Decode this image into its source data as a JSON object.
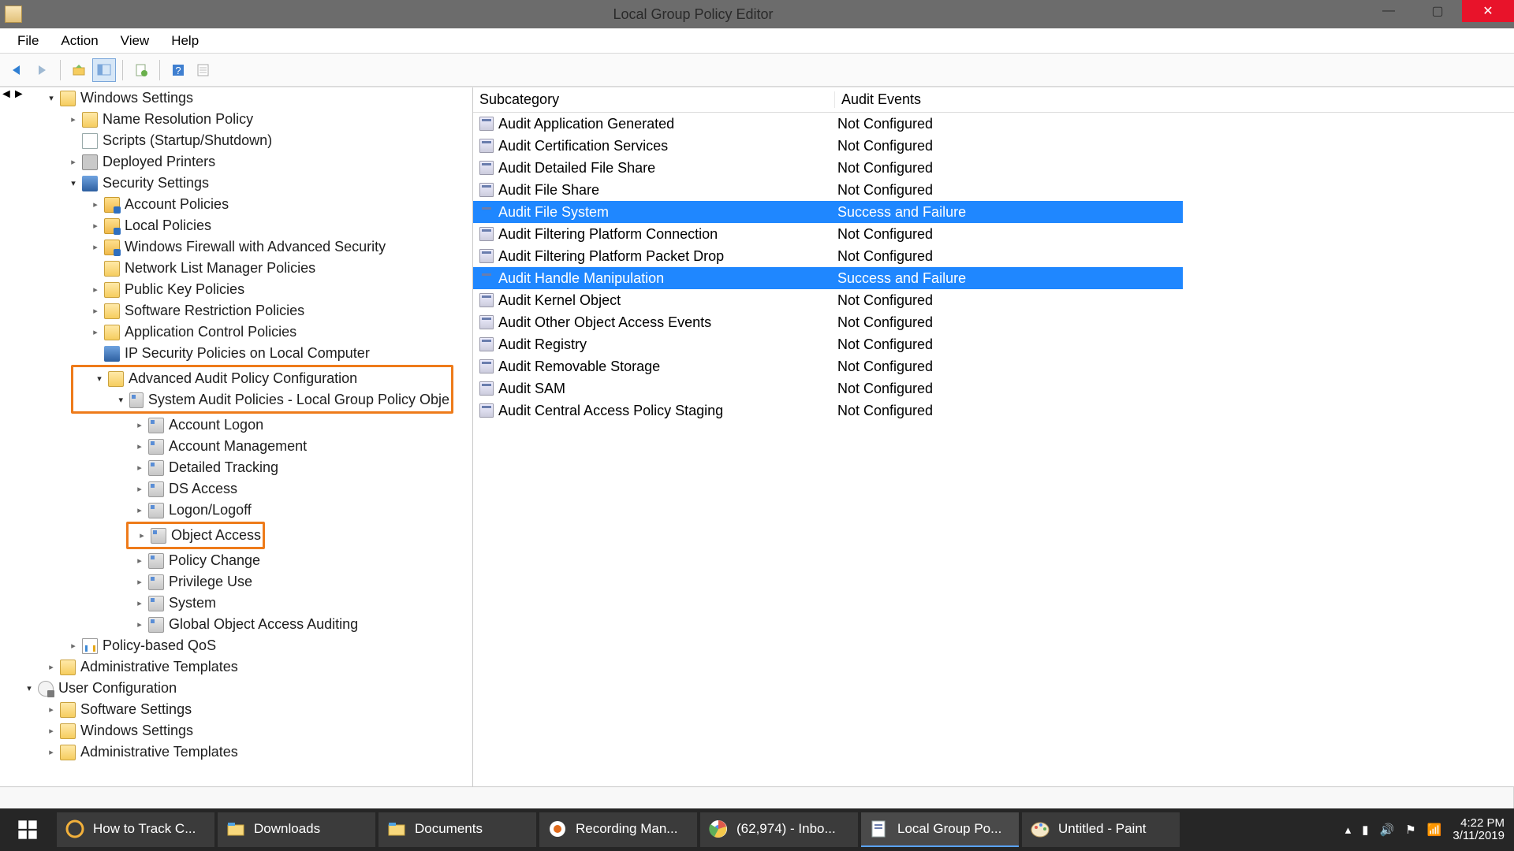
{
  "window": {
    "title": "Local Group Policy Editor",
    "menus": [
      "File",
      "Action",
      "View",
      "Help"
    ]
  },
  "toolbar": {
    "back": "◄",
    "forward": "►",
    "up": "up",
    "showhide": "showhide",
    "export": "export",
    "help": "?",
    "refresh": "refresh"
  },
  "tree": [
    {
      "depth": 1,
      "exp": "▾",
      "icon": "folder",
      "label": "Windows Settings"
    },
    {
      "depth": 2,
      "exp": "▸",
      "icon": "folder",
      "label": "Name Resolution Policy"
    },
    {
      "depth": 2,
      "exp": "",
      "icon": "script",
      "label": "Scripts (Startup/Shutdown)"
    },
    {
      "depth": 2,
      "exp": "▸",
      "icon": "printer",
      "label": "Deployed Printers"
    },
    {
      "depth": 2,
      "exp": "▾",
      "icon": "shield",
      "label": "Security Settings"
    },
    {
      "depth": 3,
      "exp": "▸",
      "icon": "folderlock",
      "label": "Account Policies"
    },
    {
      "depth": 3,
      "exp": "▸",
      "icon": "folderlock",
      "label": "Local Policies"
    },
    {
      "depth": 3,
      "exp": "▸",
      "icon": "folderlock",
      "label": "Windows Firewall with Advanced Security"
    },
    {
      "depth": 3,
      "exp": "",
      "icon": "folder",
      "label": "Network List Manager Policies"
    },
    {
      "depth": 3,
      "exp": "▸",
      "icon": "folder",
      "label": "Public Key Policies"
    },
    {
      "depth": 3,
      "exp": "▸",
      "icon": "folder",
      "label": "Software Restriction Policies"
    },
    {
      "depth": 3,
      "exp": "▸",
      "icon": "folder",
      "label": "Application Control Policies"
    },
    {
      "depth": 3,
      "exp": "",
      "icon": "shield",
      "label": "IP Security Policies on Local Computer"
    },
    {
      "depth": 3,
      "exp": "▾",
      "icon": "folder",
      "label": "Advanced Audit Policy Configuration",
      "hl": true
    },
    {
      "depth": 4,
      "exp": "▾",
      "icon": "catnode",
      "label": "System Audit Policies - Local Group Policy Obje",
      "hl": true
    },
    {
      "depth": 5,
      "exp": "▸",
      "icon": "catnode",
      "label": "Account Logon"
    },
    {
      "depth": 5,
      "exp": "▸",
      "icon": "catnode",
      "label": "Account Management"
    },
    {
      "depth": 5,
      "exp": "▸",
      "icon": "catnode",
      "label": "Detailed Tracking"
    },
    {
      "depth": 5,
      "exp": "▸",
      "icon": "catnode",
      "label": "DS Access"
    },
    {
      "depth": 5,
      "exp": "▸",
      "icon": "catnode",
      "label": "Logon/Logoff"
    },
    {
      "depth": 5,
      "exp": "▸",
      "icon": "catnode",
      "label": "Object Access",
      "hl2": true
    },
    {
      "depth": 5,
      "exp": "▸",
      "icon": "catnode",
      "label": "Policy Change"
    },
    {
      "depth": 5,
      "exp": "▸",
      "icon": "catnode",
      "label": "Privilege Use"
    },
    {
      "depth": 5,
      "exp": "▸",
      "icon": "catnode",
      "label": "System"
    },
    {
      "depth": 5,
      "exp": "▸",
      "icon": "catnode",
      "label": "Global Object Access Auditing"
    },
    {
      "depth": 2,
      "exp": "▸",
      "icon": "chart",
      "label": "Policy-based QoS"
    },
    {
      "depth": 1,
      "exp": "▸",
      "icon": "folder",
      "label": "Administrative Templates"
    },
    {
      "depth": 0,
      "exp": "▾",
      "icon": "userconf",
      "label": "User Configuration"
    },
    {
      "depth": 1,
      "exp": "▸",
      "icon": "folder",
      "label": "Software Settings"
    },
    {
      "depth": 1,
      "exp": "▸",
      "icon": "folder",
      "label": "Windows Settings"
    },
    {
      "depth": 1,
      "exp": "▸",
      "icon": "folder",
      "label": "Administrative Templates"
    }
  ],
  "list": {
    "columns": [
      "Subcategory",
      "Audit Events"
    ],
    "rows": [
      {
        "name": "Audit Application Generated",
        "val": "Not Configured"
      },
      {
        "name": "Audit Certification Services",
        "val": "Not Configured"
      },
      {
        "name": "Audit Detailed File Share",
        "val": "Not Configured"
      },
      {
        "name": "Audit File Share",
        "val": "Not Configured"
      },
      {
        "name": "Audit File System",
        "val": "Success and Failure",
        "sel": true
      },
      {
        "name": "Audit Filtering Platform Connection",
        "val": "Not Configured"
      },
      {
        "name": "Audit Filtering Platform Packet Drop",
        "val": "Not Configured"
      },
      {
        "name": "Audit Handle Manipulation",
        "val": "Success and Failure",
        "sel": true
      },
      {
        "name": "Audit Kernel Object",
        "val": "Not Configured"
      },
      {
        "name": "Audit Other Object Access Events",
        "val": "Not Configured"
      },
      {
        "name": "Audit Registry",
        "val": "Not Configured"
      },
      {
        "name": "Audit Removable Storage",
        "val": "Not Configured"
      },
      {
        "name": "Audit SAM",
        "val": "Not Configured"
      },
      {
        "name": "Audit Central Access Policy Staging",
        "val": "Not Configured"
      }
    ]
  },
  "taskbar": {
    "items": [
      {
        "label": "How to Track C...",
        "icon": "cortana"
      },
      {
        "label": "Downloads",
        "icon": "explorer"
      },
      {
        "label": "Documents",
        "icon": "explorer"
      },
      {
        "label": "Recording Man...",
        "icon": "rec"
      },
      {
        "label": "(62,974) - Inbo...",
        "icon": "chrome"
      },
      {
        "label": "Local Group Po...",
        "icon": "gpedit",
        "active": true
      },
      {
        "label": "Untitled - Paint",
        "icon": "paint"
      }
    ],
    "tray": {
      "chevron": "▴",
      "battery": "▮",
      "volume": "🔊",
      "flag": "⚑",
      "net": "📶"
    },
    "time": "4:22 PM",
    "date": "3/11/2019"
  }
}
